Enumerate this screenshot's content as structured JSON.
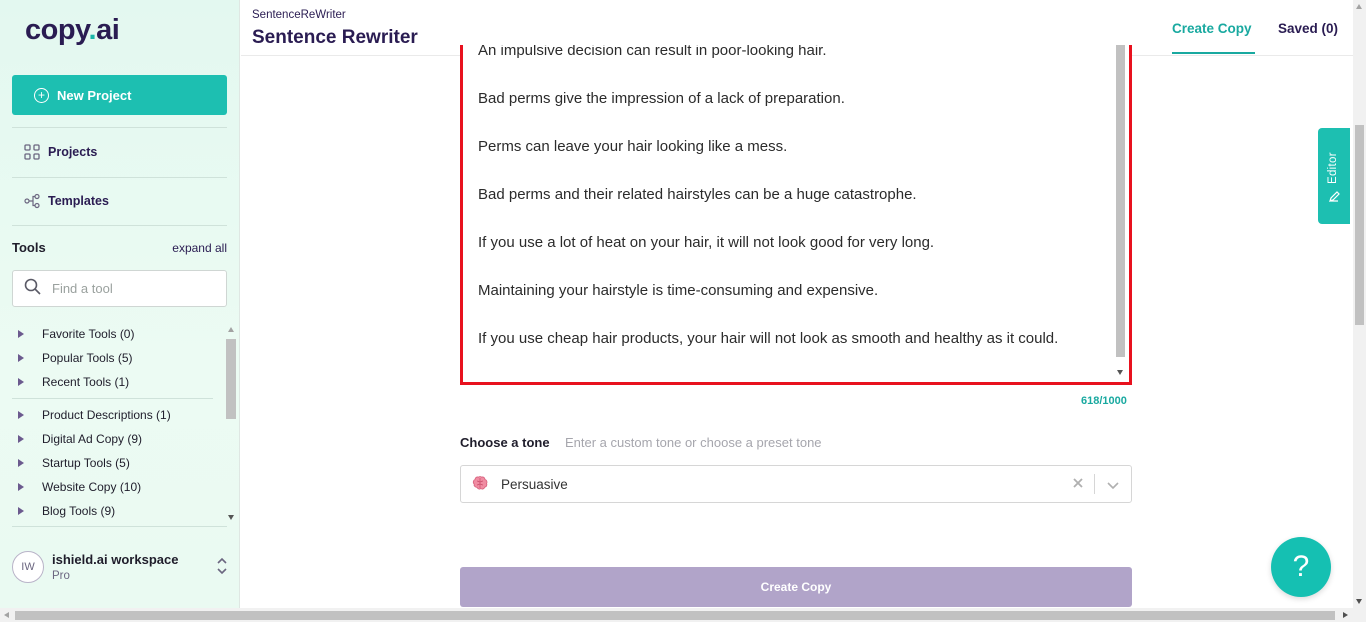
{
  "brand": {
    "logo_main": "copy",
    "logo_dot": ".",
    "logo_suffix": "ai",
    "accent": "#1dbfb1",
    "brand_dark": "#2a1c52"
  },
  "sidebar": {
    "new_project_label": "New Project",
    "nav": [
      {
        "label": "Projects",
        "icon": "grid-icon"
      },
      {
        "label": "Templates",
        "icon": "share-nodes-icon"
      }
    ],
    "tools_heading": "Tools",
    "expand_all": "expand all",
    "search_placeholder": "Find a tool",
    "tool_groups_primary": [
      {
        "label": "Favorite Tools (0)"
      },
      {
        "label": "Popular Tools (5)"
      },
      {
        "label": "Recent Tools (1)"
      }
    ],
    "tool_groups_categories": [
      {
        "label": "Product Descriptions (1)"
      },
      {
        "label": "Digital Ad Copy (9)"
      },
      {
        "label": "Startup Tools (5)"
      },
      {
        "label": "Website Copy (10)"
      },
      {
        "label": "Blog Tools (9)"
      }
    ],
    "workspace": {
      "initials": "IW",
      "name": "ishield.ai workspace",
      "plan": "Pro"
    }
  },
  "header": {
    "breadcrumb": "SentenceReWriter",
    "title": "Sentence Rewriter",
    "tabs": [
      {
        "label": "Create Copy",
        "active": true
      },
      {
        "label": "Saved (0)",
        "active": false
      }
    ]
  },
  "main": {
    "input_lines": [
      "An impulsive decision can result in poor-looking hair.",
      "Bad perms give the impression of a lack of preparation.",
      "Perms can leave your hair looking like a mess.",
      "Bad perms and their related hairstyles can be a huge catastrophe.",
      "If you use a lot of heat on your hair, it will not look good for very long.",
      "Maintaining your hairstyle is time-consuming and expensive.",
      "If you use cheap hair products, your hair will not look as smooth and healthy as it could."
    ],
    "char_counter": "618/1000",
    "tone_label": "Choose a tone",
    "tone_hint": "Enter a custom tone or choose a preset tone",
    "tone_value": "Persuasive",
    "tone_icon": "brain-icon",
    "create_button": "Create Copy"
  },
  "editor_tab": {
    "label": "Editor"
  },
  "help_button": {
    "label": "?"
  }
}
